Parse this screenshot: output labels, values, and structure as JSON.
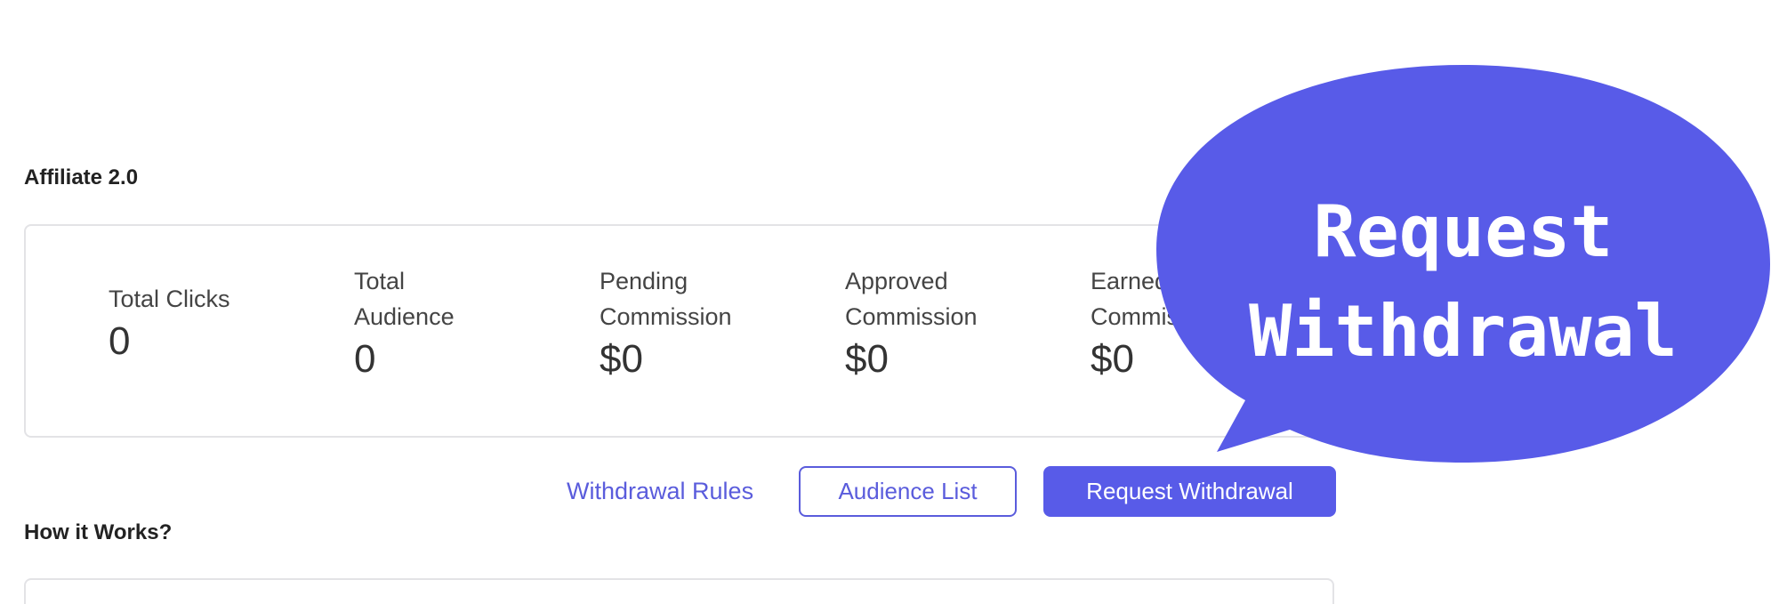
{
  "affiliate": {
    "title": "Affiliate 2.0",
    "stats": [
      {
        "label": "Total Clicks",
        "value": "0"
      },
      {
        "label": "Total\nAudience",
        "value": "0"
      },
      {
        "label": "Pending\nCommission",
        "value": "$0"
      },
      {
        "label": "Approved\nCommission",
        "value": "$0"
      },
      {
        "label": "Earned\nCommission",
        "value": "$0"
      }
    ]
  },
  "actions": {
    "withdrawal_rules": "Withdrawal Rules",
    "audience_list": "Audience List",
    "request_withdrawal": "Request Withdrawal"
  },
  "how_it_works": {
    "title": "How it Works?"
  },
  "callout": {
    "line1": "Request",
    "line2": "Withdrawal",
    "color": "#585be8"
  },
  "colors": {
    "accent": "#585be8",
    "link": "#5a5cdc",
    "border": "#e3e3e6"
  }
}
